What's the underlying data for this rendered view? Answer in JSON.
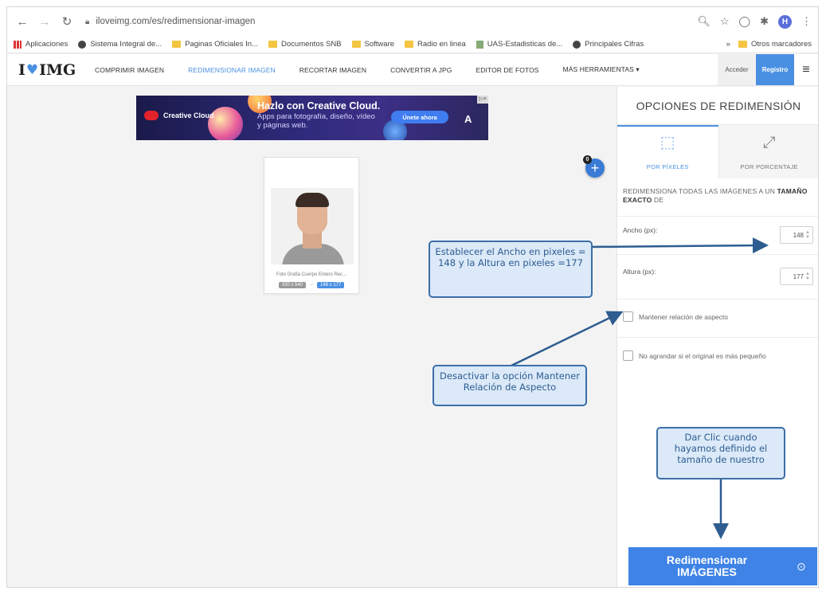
{
  "browser": {
    "url": "iloveimg.com/es/redimensionar-imagen",
    "profile_initial": "H",
    "bookmarks": [
      {
        "label": "Aplicaciones",
        "icon": "apps-icon"
      },
      {
        "label": "Sistema Integral de...",
        "icon": "globe-icon"
      },
      {
        "label": "Paginas Oficiales In...",
        "icon": "folder-icon"
      },
      {
        "label": "Documentos SNB",
        "icon": "folder-icon"
      },
      {
        "label": "Software",
        "icon": "folder-icon"
      },
      {
        "label": "Radio en linea",
        "icon": "folder-icon"
      },
      {
        "label": "UAS-Estadisticas de...",
        "icon": "doc-icon"
      },
      {
        "label": "Principales Cifras",
        "icon": "globe-icon"
      }
    ],
    "more_bookmarks": "»",
    "other_bookmarks": "Otros marcadores"
  },
  "site": {
    "logo_left": "I",
    "logo_right": "IMG",
    "menu": [
      "COMPRIMIR IMAGEN",
      "REDIMENSIONAR IMAGEN",
      "RECORTAR IMAGEN",
      "CONVERTIR A JPG",
      "EDITOR DE FOTOS",
      "MÁS HERRAMIENTAS ▾"
    ],
    "active_menu_index": 1,
    "login": "Acceder",
    "register": "Registro"
  },
  "ad": {
    "brand": "Creative Cloud",
    "headline": "Hazlo con Creative Cloud.",
    "sub": "Apps para fotografía, diseño, vídeo y páginas web.",
    "cta": "Únete ahora",
    "close": "▷×"
  },
  "upload": {
    "badge_count": "0",
    "file_name": "Foto Grafia Cuerpo Entero Rec...",
    "orig_dims": "150 x 540",
    "new_dims": "148 x 177"
  },
  "sidebar": {
    "title": "OPCIONES DE REDIMENSIÓN",
    "tab_pixels": "POR PÍXELES",
    "tab_percent": "POR PORCENTAJE",
    "desc_prefix": "REDIMENSIONA TODAS LAS IMÁGENES A UN ",
    "desc_bold": "TAMAÑO EXACTO",
    "desc_suffix": " DE",
    "width_label": "Ancho (px):",
    "width_value": "148",
    "height_label": "Altura (px):",
    "height_value": "177",
    "keep_ratio_label": "Mantener relación de aspecto",
    "no_enlarge_label": "No agrandar si el original es más pequeño",
    "button_line1": "Redimensionar",
    "button_line2": "IMÁGENES"
  },
  "callouts": {
    "pixels": "Establecer el Ancho en pixeles = 148 y la Altura en pixeles =177",
    "ratio": "Desactivar la opción Mantener Relación de Aspecto",
    "click": "Dar Clic cuando hayamos definido el tamaño de nuestro"
  },
  "colors": {
    "accent": "#4a90e2",
    "callout_border": "#3c6fa8",
    "callout_fill": "#dbe9f8"
  }
}
